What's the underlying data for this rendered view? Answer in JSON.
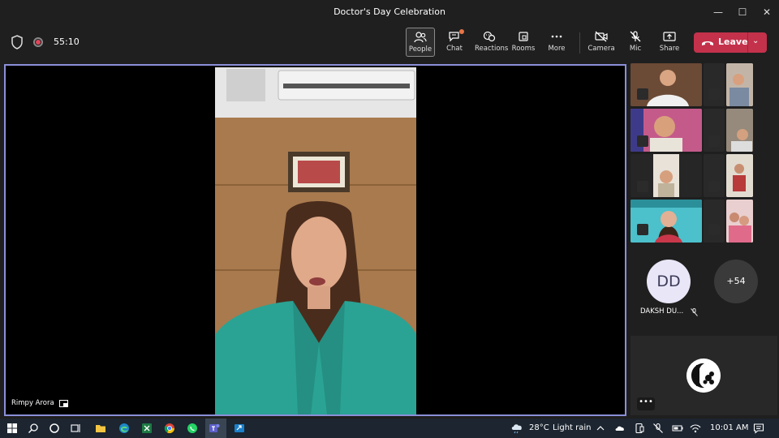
{
  "window": {
    "title": "Doctor's Day Celebration"
  },
  "meeting": {
    "timer": "55:10",
    "toolbar": {
      "people": "People",
      "chat": "Chat",
      "reactions": "Reactions",
      "rooms": "Rooms",
      "more": "More",
      "camera": "Camera",
      "mic": "Mic",
      "share": "Share",
      "leave": "Leave"
    }
  },
  "stage": {
    "speaker_name": "Rimpy Arora"
  },
  "gallery": {
    "participant_initials": "DD",
    "participant_name": "DAKSH DU...",
    "overflow_count": "+54"
  },
  "taskbar": {
    "weather_temp": "28°C",
    "weather_text": "Light rain",
    "time": "10:01 AM"
  },
  "colors": {
    "leave": "#c4314b",
    "active_border": "#8b8fd8",
    "notification": "#e97548"
  }
}
